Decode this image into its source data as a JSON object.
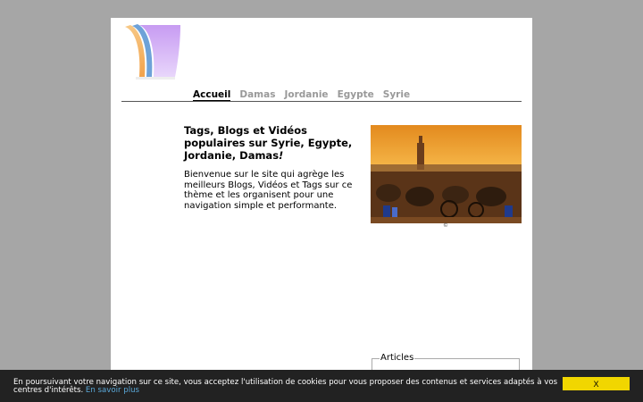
{
  "nav": {
    "items": [
      {
        "label": "Accueil",
        "active": true
      },
      {
        "label": "Damas",
        "active": false
      },
      {
        "label": "Jordanie",
        "active": false
      },
      {
        "label": "Egypte",
        "active": false
      },
      {
        "label": "Syrie",
        "active": false
      }
    ]
  },
  "main": {
    "headline": "Tags, Blogs et Vidéos populaires sur Syrie, Egypte, Jordanie, Damas",
    "headline_mark": "!",
    "intro": "Bienvenue sur le site qui agrège les meilleurs Blogs, Vidéos et Tags sur ce thème et les organisent pour une navigation simple et performante."
  },
  "photo": {
    "credit": "©"
  },
  "articles": {
    "legend": "Articles"
  },
  "cookie": {
    "text": "En poursuivant votre navigation sur ce site, vous acceptez l'utilisation de cookies pour vous proposer des contenus et services adaptés à vos centres d'intérêts.",
    "link": "En savoir plus",
    "button": "X"
  },
  "colors": {
    "background": "#a6a6a6",
    "cookie_bar": "#222222",
    "cookie_button": "#f1d600",
    "cookie_link": "#5aa8d8",
    "nav_inactive": "#999999"
  }
}
